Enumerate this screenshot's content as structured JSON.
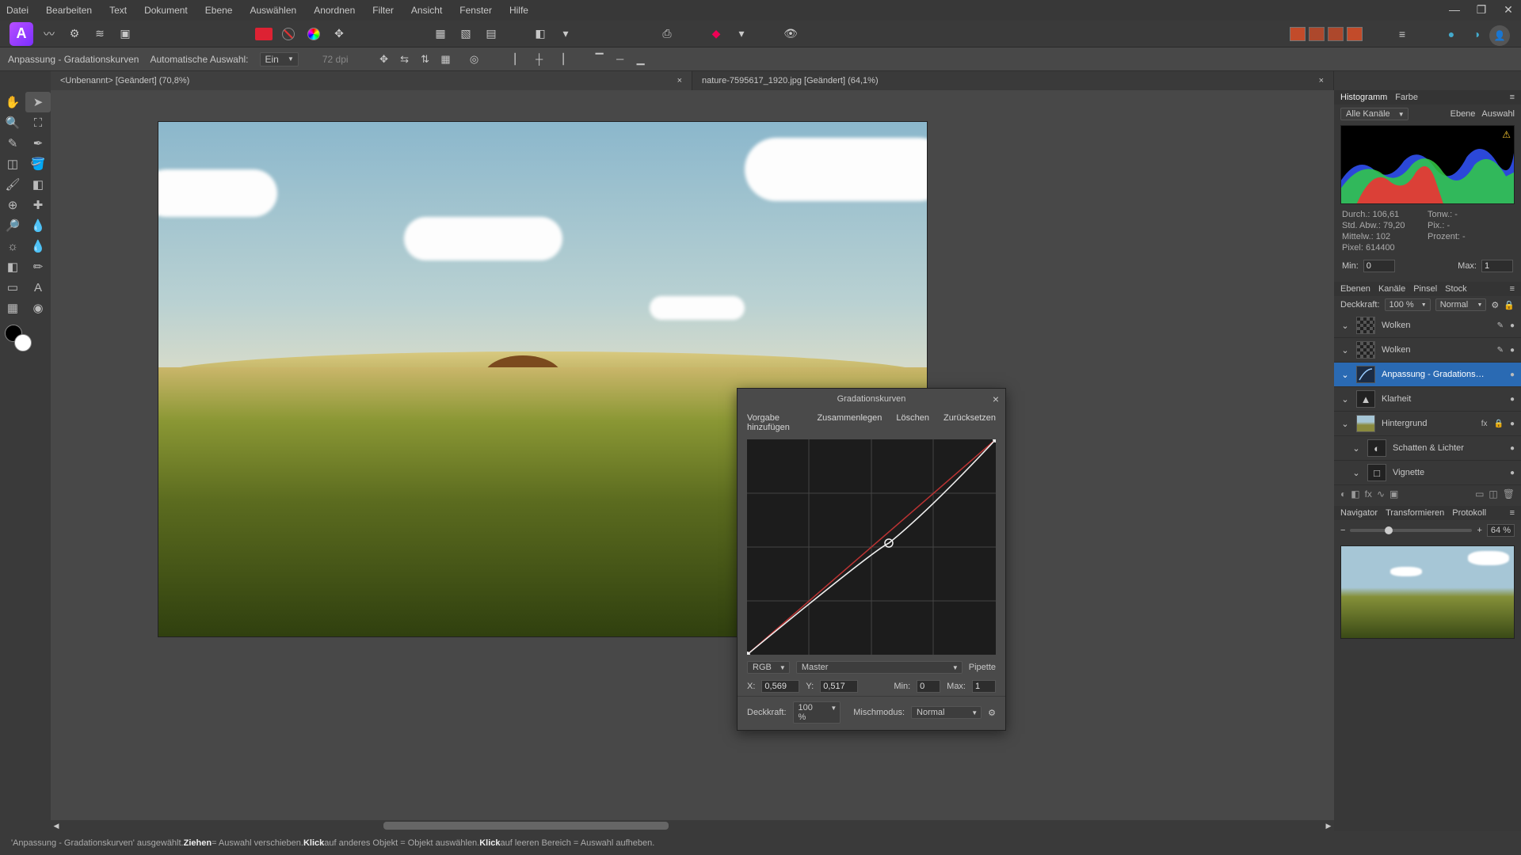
{
  "menu": {
    "items": [
      "Datei",
      "Bearbeiten",
      "Text",
      "Dokument",
      "Ebene",
      "Auswählen",
      "Anordnen",
      "Filter",
      "Ansicht",
      "Fenster",
      "Hilfe"
    ]
  },
  "win": {
    "min": "—",
    "max": "❐",
    "close": "✕"
  },
  "context": {
    "title": "Anpassung - Gradationskurven",
    "auto_label": "Automatische Auswahl:",
    "auto_value": "Ein",
    "dpi": "72 dpi"
  },
  "tabs": [
    {
      "label": "<Unbenannt> [Geändert] (70,8%)",
      "active": true
    },
    {
      "label": "nature-7595617_1920.jpg [Geändert] (64,1%)",
      "active": false
    }
  ],
  "histo_panel": {
    "tabs": [
      "Histogramm",
      "Farbe"
    ],
    "channel": "Alle Kanäle",
    "btn_layer": "Ebene",
    "btn_sel": "Auswahl",
    "stats": {
      "durch": "Durch.:",
      "durch_v": "106,61",
      "std": "Std. Abw.:",
      "std_v": "79,20",
      "mittel": "Mittelw.:",
      "mittel_v": "102",
      "pixel": "Pixel:",
      "pixel_v": "614400",
      "tonw": "Tonw.:",
      "tonw_v": "-",
      "pix": "Pix.:",
      "pix_v": "-",
      "proz": "Prozent:",
      "proz_v": "-"
    },
    "min_lbl": "Min:",
    "min_v": "0",
    "max_lbl": "Max:",
    "max_v": "1"
  },
  "layers_panel": {
    "tabs": [
      "Ebenen",
      "Kanäle",
      "Pinsel",
      "Stock"
    ],
    "opacity_lbl": "Deckkraft:",
    "opacity_v": "100 %",
    "blend": "Normal",
    "layers": [
      {
        "name": "Wolken",
        "thumb": "checker",
        "extras": [
          "✎",
          "●"
        ]
      },
      {
        "name": "Wolken",
        "thumb": "checker",
        "extras": [
          "✎",
          "●"
        ]
      },
      {
        "name": "Anpassung - Gradations…",
        "thumb": "curves",
        "sel": true,
        "extras": [
          "●"
        ]
      },
      {
        "name": "Klarheit",
        "thumb": "icon",
        "icon": "▲",
        "extras": [
          "●"
        ]
      },
      {
        "name": "Hintergrund",
        "thumb": "img",
        "extras": [
          "fx",
          "🔒",
          "●"
        ]
      },
      {
        "name": "Schatten & Lichter",
        "thumb": "icon",
        "icon": "◐",
        "indent": true,
        "extras": [
          "●"
        ]
      },
      {
        "name": "Vignette",
        "thumb": "icon",
        "icon": "□",
        "indent": true,
        "extras": [
          "●"
        ]
      }
    ]
  },
  "nav_panel": {
    "tabs": [
      "Navigator",
      "Transformieren",
      "Protokoll"
    ],
    "zoom_val": "64 %"
  },
  "curves": {
    "title": "Gradationskurven",
    "preset": "Vorgabe hinzufügen",
    "merge": "Zusammenlegen",
    "delete": "Löschen",
    "reset": "Zurücksetzen",
    "rgb": "RGB",
    "master": "Master",
    "pipette": "Pipette",
    "x_lbl": "X:",
    "x_v": "0,569",
    "y_lbl": "Y:",
    "y_v": "0,517",
    "min_lbl": "Min:",
    "min_v": "0",
    "max_lbl": "Max:",
    "max_v": "1",
    "opacity_lbl": "Deckkraft:",
    "opacity_v": "100 %",
    "blend_lbl": "Mischmodus:",
    "blend_v": "Normal"
  },
  "status": {
    "pre": "'Anpassung - Gradationskurven' ausgewählt. ",
    "b1": "Ziehen",
    "t1": " = Auswahl verschieben. ",
    "b2": "Klick",
    "t2": " auf anderes Objekt = Objekt auswählen. ",
    "b3": "Klick",
    "t3": " auf leeren Bereich = Auswahl aufheben."
  }
}
